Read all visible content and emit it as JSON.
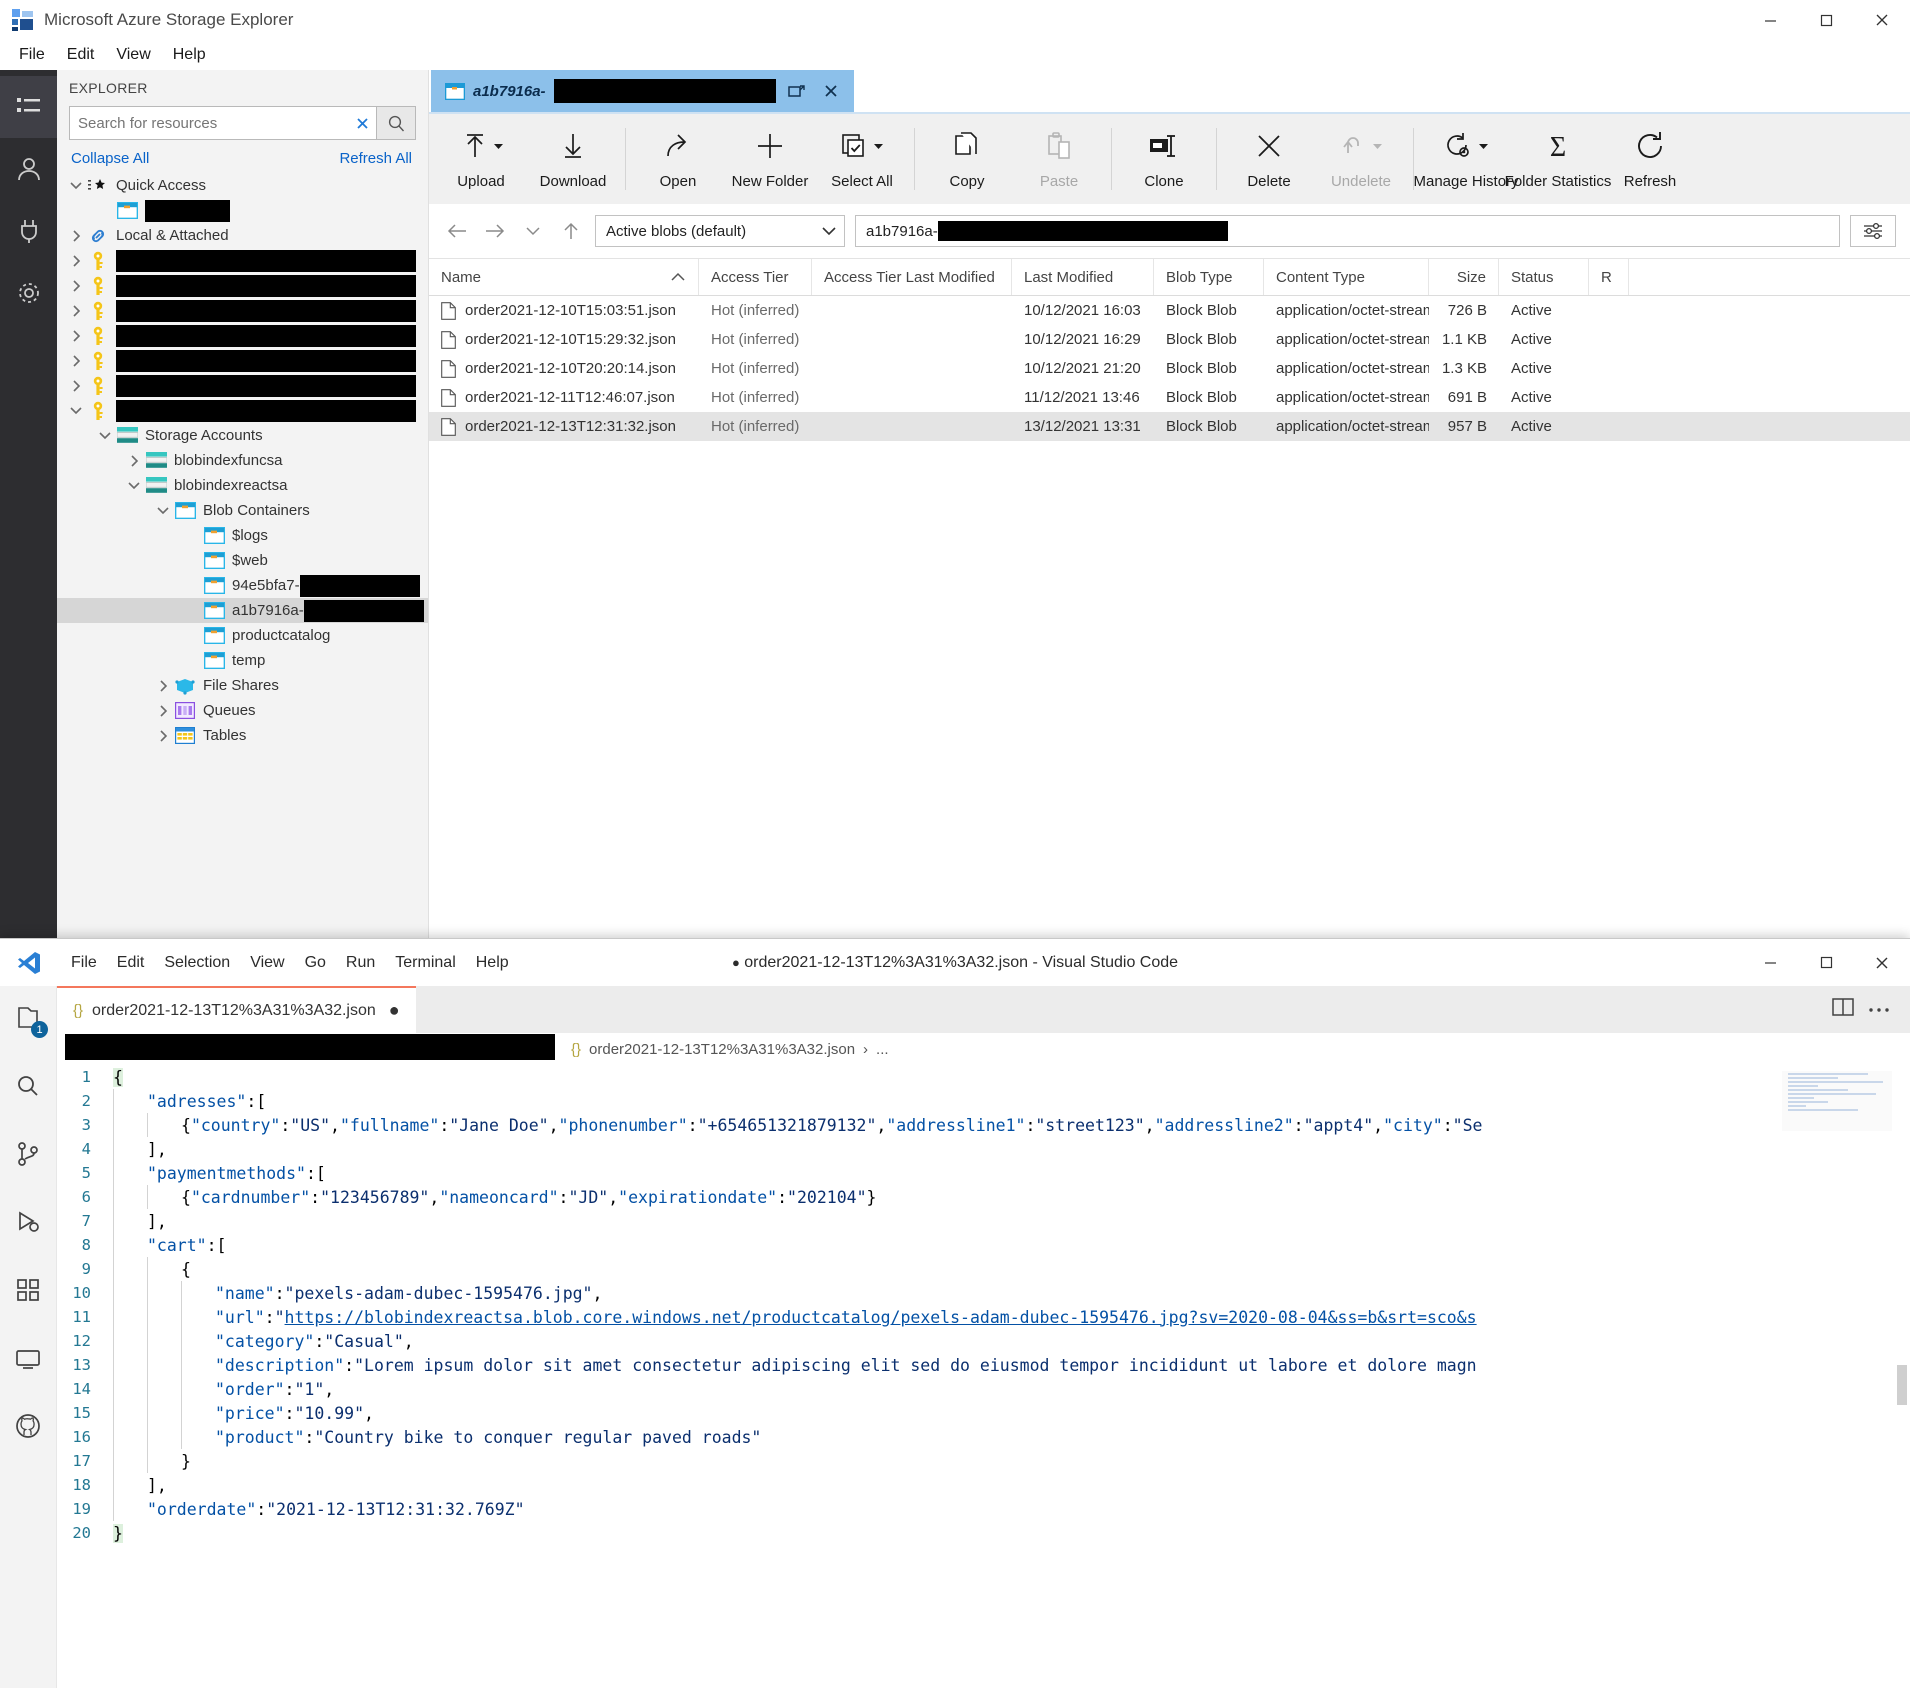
{
  "azure": {
    "window_title": "Microsoft Azure Storage Explorer",
    "menu": [
      "File",
      "Edit",
      "View",
      "Help"
    ],
    "window_controls": [
      "minimize",
      "maximize",
      "close"
    ],
    "explorer": {
      "header": "EXPLORER",
      "search_placeholder": "Search for resources",
      "search_value": "",
      "collapse_all": "Collapse All",
      "refresh_all": "Refresh All",
      "tree": [
        {
          "label": "Quick Access",
          "icon": "quick-access-icon",
          "chevron": "down",
          "depth": 0,
          "redacted": false
        },
        {
          "label": "",
          "icon": "blob-container-icon",
          "chevron": "none",
          "depth": 1,
          "redacted": true,
          "redact_width": 85
        },
        {
          "label": "Local & Attached",
          "icon": "link-icon",
          "chevron": "right",
          "depth": 0,
          "redacted": false
        },
        {
          "label": "",
          "icon": "key-icon",
          "chevron": "right",
          "depth": 0,
          "redacted": true,
          "redact_width": 300
        },
        {
          "label": "",
          "icon": "key-icon",
          "chevron": "right",
          "depth": 0,
          "redacted": true,
          "redact_width": 300
        },
        {
          "label": "",
          "icon": "key-icon",
          "chevron": "right",
          "depth": 0,
          "redacted": true,
          "redact_width": 300
        },
        {
          "label": "",
          "icon": "key-icon",
          "chevron": "right",
          "depth": 0,
          "redacted": true,
          "redact_width": 300
        },
        {
          "label": "",
          "icon": "key-icon",
          "chevron": "right",
          "depth": 0,
          "redacted": true,
          "redact_width": 300
        },
        {
          "label": "",
          "icon": "key-icon",
          "chevron": "right",
          "depth": 0,
          "redacted": true,
          "redact_width": 300
        },
        {
          "label": "",
          "icon": "key-icon",
          "chevron": "down",
          "depth": 0,
          "redacted": true,
          "redact_width": 300
        },
        {
          "label": "Storage Accounts",
          "icon": "storage-account-icon",
          "chevron": "down",
          "depth": 1,
          "redacted": false
        },
        {
          "label": "blobindexfuncsa",
          "icon": "storage-account-icon",
          "chevron": "right",
          "depth": 2,
          "redacted": false
        },
        {
          "label": "blobindexreactsa",
          "icon": "storage-account-icon",
          "chevron": "down",
          "depth": 2,
          "redacted": false
        },
        {
          "label": "Blob Containers",
          "icon": "blob-container-icon",
          "chevron": "down",
          "depth": 3,
          "redacted": false
        },
        {
          "label": "$logs",
          "icon": "blob-container-icon",
          "chevron": "none",
          "depth": 4,
          "redacted": false
        },
        {
          "label": "$web",
          "icon": "blob-container-icon",
          "chevron": "none",
          "depth": 4,
          "redacted": false
        },
        {
          "label": "94e5bfa7-",
          "icon": "blob-container-icon",
          "chevron": "none",
          "depth": 4,
          "redacted": true,
          "redact_width": 120
        },
        {
          "label": "a1b7916a-",
          "icon": "blob-container-icon",
          "chevron": "none",
          "depth": 4,
          "redacted": true,
          "redact_width": 120,
          "selected": true
        },
        {
          "label": "productcatalog",
          "icon": "blob-container-icon",
          "chevron": "none",
          "depth": 4,
          "redacted": false
        },
        {
          "label": "temp",
          "icon": "blob-container-icon",
          "chevron": "none",
          "depth": 4,
          "redacted": false
        },
        {
          "label": "File Shares",
          "icon": "file-shares-icon",
          "chevron": "right",
          "depth": 3,
          "redacted": false
        },
        {
          "label": "Queues",
          "icon": "queues-icon",
          "chevron": "right",
          "depth": 3,
          "redacted": false
        },
        {
          "label": "Tables",
          "icon": "tables-icon",
          "chevron": "right",
          "depth": 3,
          "redacted": false
        }
      ]
    },
    "tab": {
      "title": "a1b7916a-",
      "redacted_suffix": true
    },
    "toolbar": [
      {
        "label": "Upload",
        "icon": "upload-icon",
        "caret": true,
        "disabled": false
      },
      {
        "label": "Download",
        "icon": "download-icon",
        "caret": false,
        "disabled": false
      },
      {
        "label": "Open",
        "icon": "open-icon",
        "caret": false,
        "disabled": false,
        "sep_before": true
      },
      {
        "label": "New Folder",
        "icon": "new-folder-icon",
        "caret": false,
        "disabled": false
      },
      {
        "label": "Select All",
        "icon": "select-all-icon",
        "caret": true,
        "disabled": false
      },
      {
        "label": "Copy",
        "icon": "copy-icon",
        "caret": false,
        "disabled": false,
        "sep_before": true
      },
      {
        "label": "Paste",
        "icon": "paste-icon",
        "caret": false,
        "disabled": true
      },
      {
        "label": "Clone",
        "icon": "clone-icon",
        "caret": false,
        "disabled": false,
        "sep_before": true
      },
      {
        "label": "Delete",
        "icon": "delete-icon",
        "caret": false,
        "disabled": false,
        "sep_before": true
      },
      {
        "label": "Undelete",
        "icon": "undelete-icon",
        "caret": true,
        "disabled": true
      },
      {
        "label": "Manage History",
        "icon": "manage-history-icon",
        "caret": true,
        "disabled": false,
        "sep_before": true
      },
      {
        "label": "Folder Statistics",
        "icon": "folder-statistics-icon",
        "caret": false,
        "disabled": false
      },
      {
        "label": "Refresh",
        "icon": "refresh-icon",
        "caret": false,
        "disabled": false
      }
    ],
    "navbar": {
      "back": "back-arrow",
      "forward": "forward-arrow",
      "history": "history-chevron",
      "up": "up-arrow",
      "filter_value": "Active blobs (default)",
      "path_value": "a1b7916a-",
      "path_redacted": true,
      "settings_icon": "filter-settings-icon"
    },
    "grid": {
      "columns": [
        "Name",
        "Access Tier",
        "Access Tier Last Modified",
        "Last Modified",
        "Blob Type",
        "Content Type",
        "Size",
        "Status",
        "R"
      ],
      "sort_column": "Name",
      "sort_direction": "asc",
      "rows": [
        {
          "name": "order2021-12-10T15:03:51.json",
          "tier": "Hot (inferred)",
          "tier_lm": "",
          "lm": "10/12/2021 16:03",
          "btype": "Block Blob",
          "ctype": "application/octet-stream",
          "size": "726 B",
          "status": "Active",
          "selected": false
        },
        {
          "name": "order2021-12-10T15:29:32.json",
          "tier": "Hot (inferred)",
          "tier_lm": "",
          "lm": "10/12/2021 16:29",
          "btype": "Block Blob",
          "ctype": "application/octet-stream",
          "size": "1.1 KB",
          "status": "Active",
          "selected": false
        },
        {
          "name": "order2021-12-10T20:20:14.json",
          "tier": "Hot (inferred)",
          "tier_lm": "",
          "lm": "10/12/2021 21:20",
          "btype": "Block Blob",
          "ctype": "application/octet-stream",
          "size": "1.3 KB",
          "status": "Active",
          "selected": false
        },
        {
          "name": "order2021-12-11T12:46:07.json",
          "tier": "Hot (inferred)",
          "tier_lm": "",
          "lm": "11/12/2021 13:46",
          "btype": "Block Blob",
          "ctype": "application/octet-stream",
          "size": "691 B",
          "status": "Active",
          "selected": false
        },
        {
          "name": "order2021-12-13T12:31:32.json",
          "tier": "Hot (inferred)",
          "tier_lm": "",
          "lm": "13/12/2021 13:31",
          "btype": "Block Blob",
          "ctype": "application/octet-stream",
          "size": "957 B",
          "status": "Active",
          "selected": true
        }
      ]
    }
  },
  "vscode": {
    "menu": [
      "File",
      "Edit",
      "Selection",
      "View",
      "Go",
      "Run",
      "Terminal",
      "Help"
    ],
    "document_title": "order2021-12-13T12%3A31%3A32.json - Visual Studio Code",
    "dirty_marker": "●",
    "window_controls": [
      "minimize",
      "maximize",
      "close"
    ],
    "tab": {
      "label": "order2021-12-13T12%3A31%3A32.json",
      "dirty": "●",
      "brace": "{}"
    },
    "tab_actions": [
      "split-editor-icon",
      "more-actions-icon"
    ],
    "breadcrumb": {
      "redacted": true,
      "brace": "{}",
      "file": "order2021-12-13T12%3A31%3A32.json",
      "separator": "›",
      "tail": "..."
    },
    "activity_bar": [
      {
        "icon": "explorer-icon",
        "badge": "1"
      },
      {
        "icon": "search-icon",
        "badge": ""
      },
      {
        "icon": "source-control-icon",
        "badge": ""
      },
      {
        "icon": "run-debug-icon",
        "badge": ""
      },
      {
        "icon": "extensions-icon",
        "badge": ""
      },
      {
        "icon": "remote-explorer-icon",
        "badge": ""
      },
      {
        "icon": "github-icon",
        "badge": ""
      }
    ],
    "code_lines": [
      {
        "n": "1",
        "indent": 0,
        "tokens": [
          {
            "t": "pun",
            "v": "{"
          }
        ],
        "highlight": true
      },
      {
        "n": "2",
        "indent": 1,
        "tokens": [
          {
            "t": "key",
            "v": "\"adresses\""
          },
          {
            "t": "pun",
            "v": ":["
          }
        ]
      },
      {
        "n": "3",
        "indent": 2,
        "tokens": [
          {
            "t": "pun",
            "v": "{"
          },
          {
            "t": "key",
            "v": "\"country\""
          },
          {
            "t": "pun",
            "v": ":"
          },
          {
            "t": "str",
            "v": "\"US\""
          },
          {
            "t": "pun",
            "v": ","
          },
          {
            "t": "key",
            "v": "\"fullname\""
          },
          {
            "t": "pun",
            "v": ":"
          },
          {
            "t": "str",
            "v": "\"Jane Doe\""
          },
          {
            "t": "pun",
            "v": ","
          },
          {
            "t": "key",
            "v": "\"phonenumber\""
          },
          {
            "t": "pun",
            "v": ":"
          },
          {
            "t": "str",
            "v": "\"+654651321879132\""
          },
          {
            "t": "pun",
            "v": ","
          },
          {
            "t": "key",
            "v": "\"addressline1\""
          },
          {
            "t": "pun",
            "v": ":"
          },
          {
            "t": "str",
            "v": "\"street123\""
          },
          {
            "t": "pun",
            "v": ","
          },
          {
            "t": "key",
            "v": "\"addressline2\""
          },
          {
            "t": "pun",
            "v": ":"
          },
          {
            "t": "str",
            "v": "\"appt4\""
          },
          {
            "t": "pun",
            "v": ","
          },
          {
            "t": "key",
            "v": "\"city\""
          },
          {
            "t": "pun",
            "v": ":"
          },
          {
            "t": "str",
            "v": "\"Se"
          }
        ]
      },
      {
        "n": "4",
        "indent": 1,
        "tokens": [
          {
            "t": "pun",
            "v": "],"
          }
        ]
      },
      {
        "n": "5",
        "indent": 1,
        "tokens": [
          {
            "t": "key",
            "v": "\"paymentmethods\""
          },
          {
            "t": "pun",
            "v": ":["
          }
        ]
      },
      {
        "n": "6",
        "indent": 2,
        "tokens": [
          {
            "t": "pun",
            "v": "{"
          },
          {
            "t": "key",
            "v": "\"cardnumber\""
          },
          {
            "t": "pun",
            "v": ":"
          },
          {
            "t": "str",
            "v": "\"123456789\""
          },
          {
            "t": "pun",
            "v": ","
          },
          {
            "t": "key",
            "v": "\"nameoncard\""
          },
          {
            "t": "pun",
            "v": ":"
          },
          {
            "t": "str",
            "v": "\"JD\""
          },
          {
            "t": "pun",
            "v": ","
          },
          {
            "t": "key",
            "v": "\"expirationdate\""
          },
          {
            "t": "pun",
            "v": ":"
          },
          {
            "t": "str",
            "v": "\"202104\""
          },
          {
            "t": "pun",
            "v": "}"
          }
        ]
      },
      {
        "n": "7",
        "indent": 1,
        "tokens": [
          {
            "t": "pun",
            "v": "],"
          }
        ]
      },
      {
        "n": "8",
        "indent": 1,
        "tokens": [
          {
            "t": "key",
            "v": "\"cart\""
          },
          {
            "t": "pun",
            "v": ":["
          }
        ]
      },
      {
        "n": "9",
        "indent": 2,
        "tokens": [
          {
            "t": "pun",
            "v": "{"
          }
        ]
      },
      {
        "n": "10",
        "indent": 3,
        "tokens": [
          {
            "t": "key",
            "v": "\"name\""
          },
          {
            "t": "pun",
            "v": ":"
          },
          {
            "t": "str",
            "v": "\"pexels-adam-dubec-1595476.jpg\""
          },
          {
            "t": "pun",
            "v": ","
          }
        ]
      },
      {
        "n": "11",
        "indent": 3,
        "tokens": [
          {
            "t": "key",
            "v": "\"url\""
          },
          {
            "t": "pun",
            "v": ":"
          },
          {
            "t": "str",
            "v": "\""
          },
          {
            "t": "url",
            "v": "https://blobindexreactsa.blob.core.windows.net/productcatalog/pexels-adam-dubec-1595476.jpg?sv=2020-08-04&ss=b&srt=sco&s"
          }
        ]
      },
      {
        "n": "12",
        "indent": 3,
        "tokens": [
          {
            "t": "key",
            "v": "\"category\""
          },
          {
            "t": "pun",
            "v": ":"
          },
          {
            "t": "str",
            "v": "\"Casual\""
          },
          {
            "t": "pun",
            "v": ","
          }
        ]
      },
      {
        "n": "13",
        "indent": 3,
        "tokens": [
          {
            "t": "key",
            "v": "\"description\""
          },
          {
            "t": "pun",
            "v": ":"
          },
          {
            "t": "str",
            "v": "\"Lorem ipsum dolor sit amet consectetur adipiscing elit sed do eiusmod tempor incididunt ut labore et dolore magn"
          }
        ]
      },
      {
        "n": "14",
        "indent": 3,
        "tokens": [
          {
            "t": "key",
            "v": "\"order\""
          },
          {
            "t": "pun",
            "v": ":"
          },
          {
            "t": "str",
            "v": "\"1\""
          },
          {
            "t": "pun",
            "v": ","
          }
        ]
      },
      {
        "n": "15",
        "indent": 3,
        "tokens": [
          {
            "t": "key",
            "v": "\"price\""
          },
          {
            "t": "pun",
            "v": ":"
          },
          {
            "t": "str",
            "v": "\"10.99\""
          },
          {
            "t": "pun",
            "v": ","
          }
        ]
      },
      {
        "n": "16",
        "indent": 3,
        "tokens": [
          {
            "t": "key",
            "v": "\"product\""
          },
          {
            "t": "pun",
            "v": ":"
          },
          {
            "t": "str",
            "v": "\"Country bike to conquer regular paved roads\""
          }
        ]
      },
      {
        "n": "17",
        "indent": 2,
        "tokens": [
          {
            "t": "pun",
            "v": "}"
          }
        ]
      },
      {
        "n": "18",
        "indent": 1,
        "tokens": [
          {
            "t": "pun",
            "v": "],"
          }
        ]
      },
      {
        "n": "19",
        "indent": 1,
        "tokens": [
          {
            "t": "key",
            "v": "\"orderdate\""
          },
          {
            "t": "pun",
            "v": ":"
          },
          {
            "t": "str",
            "v": "\"2021-12-13T12:31:32.769Z\""
          }
        ]
      },
      {
        "n": "20",
        "indent": 0,
        "tokens": [
          {
            "t": "pun",
            "v": "}"
          }
        ],
        "highlight": true
      }
    ]
  },
  "colors": {
    "tab_active": "#8cc0ea",
    "accent_link": "#0a63c9",
    "vscode_tab_border": "#f4775c",
    "selection_gray": "#e4e4e4"
  }
}
